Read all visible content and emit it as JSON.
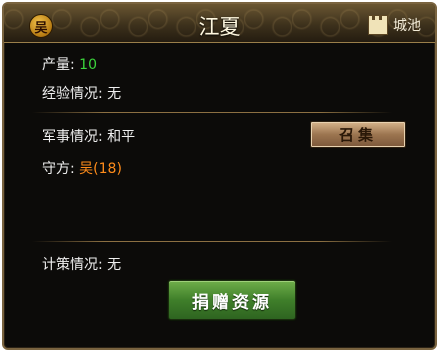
{
  "header": {
    "faction_badge": "吴",
    "title": "江夏",
    "city_button_label": "城池"
  },
  "info": {
    "output_label": "产量:",
    "output_value": "10",
    "experience_label": "经验情况:",
    "experience_value": "无",
    "military_label": "军事情况:",
    "military_value": "和平",
    "defender_label": "守方:",
    "defender_value": "吴(18)",
    "strategy_label": "计策情况:",
    "strategy_value": "无"
  },
  "buttons": {
    "summon_label": "召集",
    "donate_label": "捐赠资源"
  },
  "colors": {
    "output_value": "#3cd43c",
    "defender_value": "#ff8c1a",
    "donate_button": "#3f7f2a",
    "summon_button": "#9c7550"
  }
}
